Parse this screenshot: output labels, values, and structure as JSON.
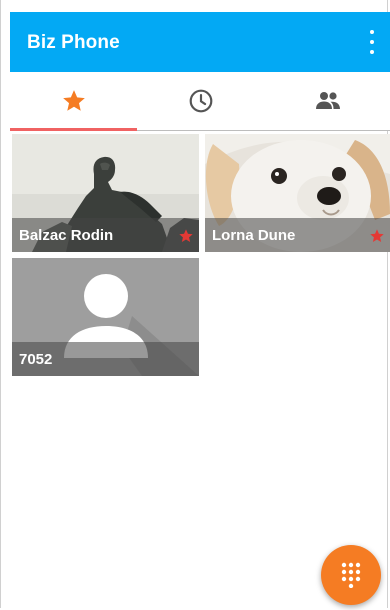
{
  "app": {
    "title": "Biz Phone"
  },
  "tabs": [
    {
      "name": "favorites",
      "icon": "star-icon",
      "selected": true
    },
    {
      "name": "recents",
      "icon": "clock-icon",
      "selected": false
    },
    {
      "name": "contacts",
      "icon": "people-icon",
      "selected": false
    }
  ],
  "favorites": [
    {
      "label": "Balzac Rodin",
      "image": "statue-photo",
      "starred": true
    },
    {
      "label": "Lorna Dune",
      "image": "dog-photo",
      "starred": true
    },
    {
      "label": "7052",
      "image": "default-avatar",
      "starred": false
    }
  ],
  "fab": {
    "icon": "dialpad-icon"
  },
  "colors": {
    "appbar": "#03A9F4",
    "accent": "#F57C23",
    "tab_indicator": "#F06262",
    "star": "#E53935"
  }
}
